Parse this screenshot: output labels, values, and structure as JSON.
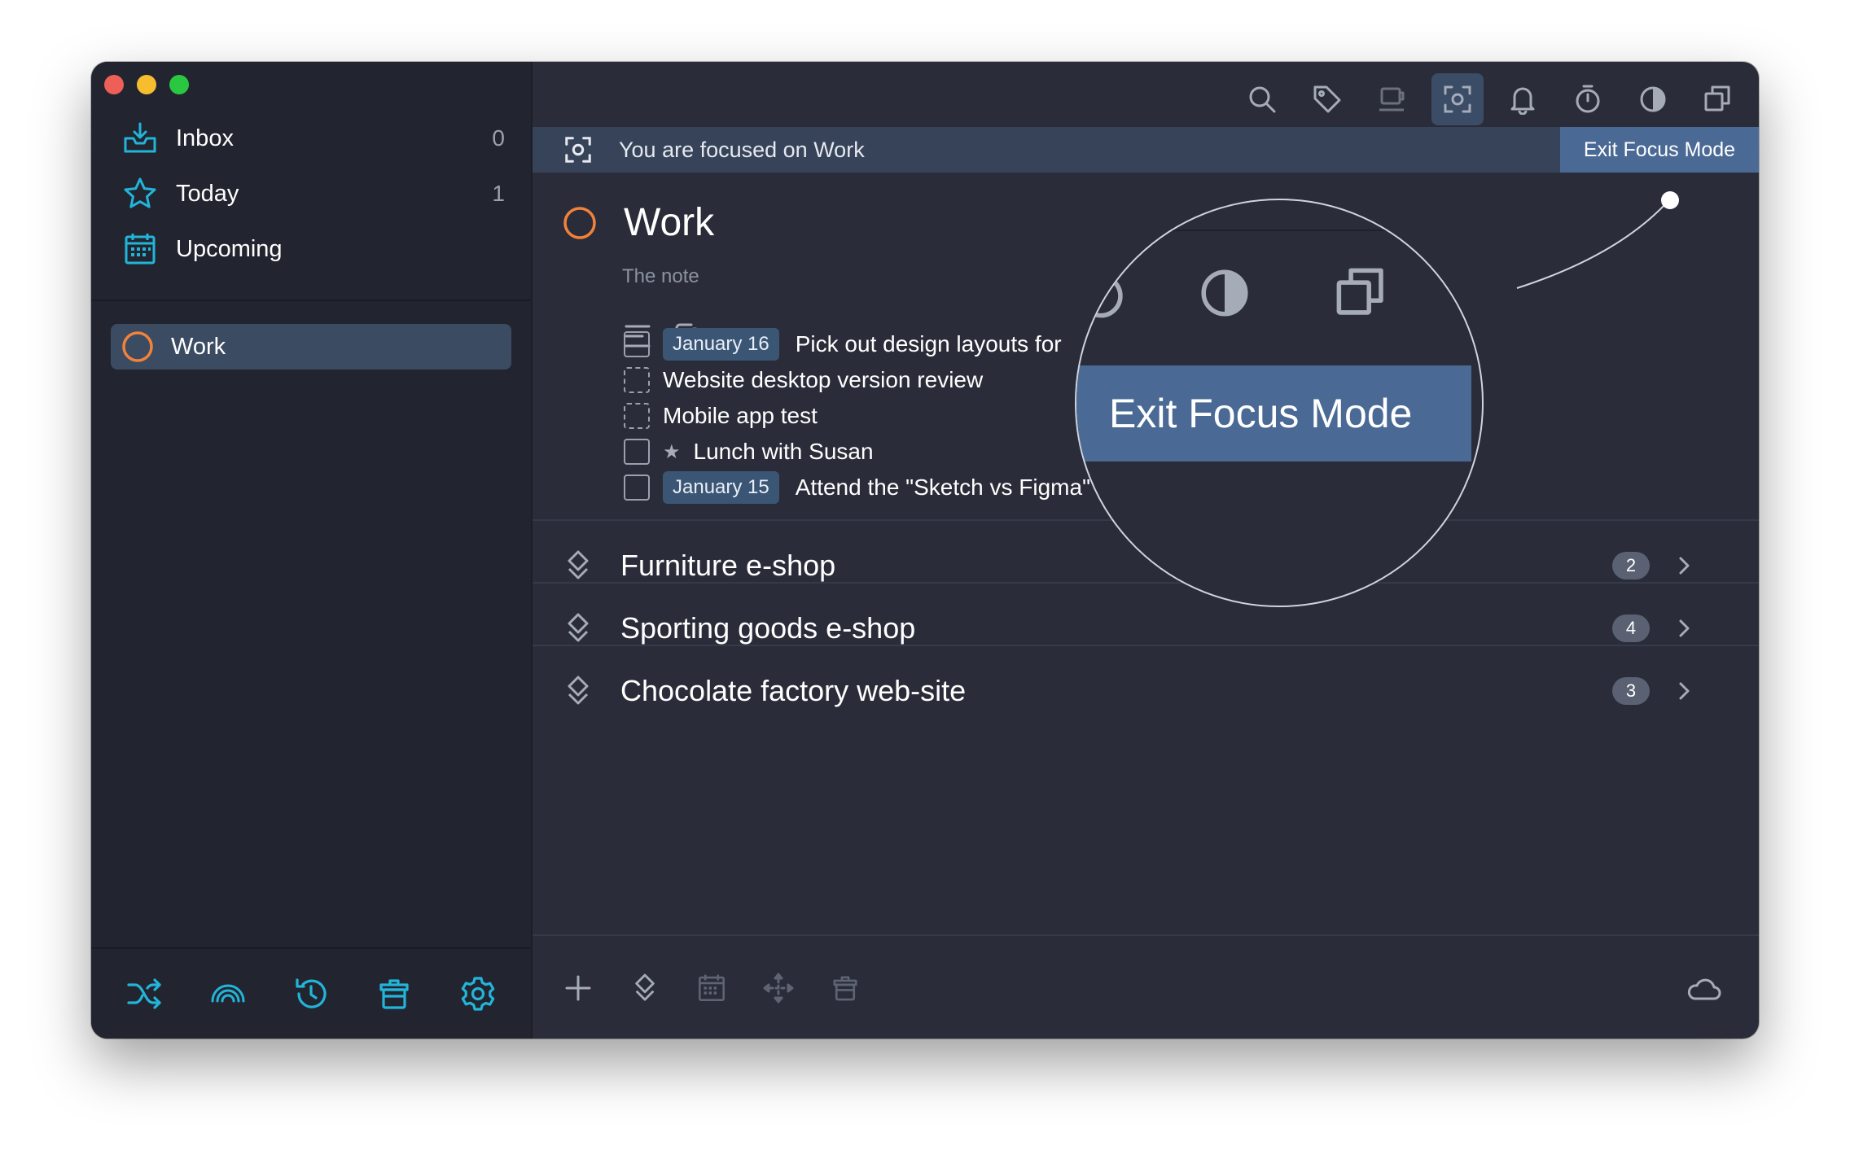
{
  "sidebar": {
    "nav": [
      {
        "label": "Inbox",
        "count": "0",
        "icon": "inbox-icon"
      },
      {
        "label": "Today",
        "count": "1",
        "icon": "star-icon"
      },
      {
        "label": "Upcoming",
        "count": "",
        "icon": "calendar-icon"
      }
    ],
    "projects": [
      {
        "label": "Work",
        "icon": "circle-icon"
      }
    ],
    "bottom_icons": [
      "shuffle-icon",
      "rainbow-icon",
      "history-icon",
      "trash-icon",
      "gear-icon"
    ]
  },
  "toolbar": {
    "icons": [
      "search-icon",
      "tag-icon",
      "coffee-icon",
      "focus-icon",
      "bell-icon",
      "stopwatch-icon",
      "contrast-icon",
      "copy-icon"
    ],
    "active": "focus-icon"
  },
  "banner": {
    "text": "You are focused on Work",
    "exit_label": "Exit Focus Mode"
  },
  "project": {
    "title": "Work",
    "note": "The note",
    "tasks": [
      {
        "date": "January 16",
        "title": "Pick out design layouts for",
        "checkbox": "solid"
      },
      {
        "date": "",
        "title": "Website desktop version review",
        "checkbox": "dashed"
      },
      {
        "date": "",
        "title": "Mobile app test",
        "checkbox": "dashed"
      },
      {
        "date": "",
        "title": "Lunch with Susan",
        "checkbox": "solid",
        "starred": true
      },
      {
        "date": "January 15",
        "title": "Attend the \"Sketch vs Figma\" holywar",
        "checkbox": "solid",
        "has_note": true
      }
    ]
  },
  "groups": [
    {
      "title": "Furniture e-shop",
      "count": "2"
    },
    {
      "title": "Sporting goods e-shop",
      "count": "4"
    },
    {
      "title": "Chocolate factory web-site",
      "count": "3"
    }
  ],
  "main_bottom_icons": [
    "plus-icon",
    "group-icon",
    "calendar-icon",
    "move-icon",
    "trash-icon",
    "cloud-icon"
  ],
  "zoom": {
    "exit_label": "Exit Focus Mode"
  },
  "colors": {
    "accent": "#22b5d9",
    "project": "#f2823a",
    "focus_banner": "#364359",
    "exit_button": "#4a6a95",
    "date_tag": "#3b5675"
  }
}
